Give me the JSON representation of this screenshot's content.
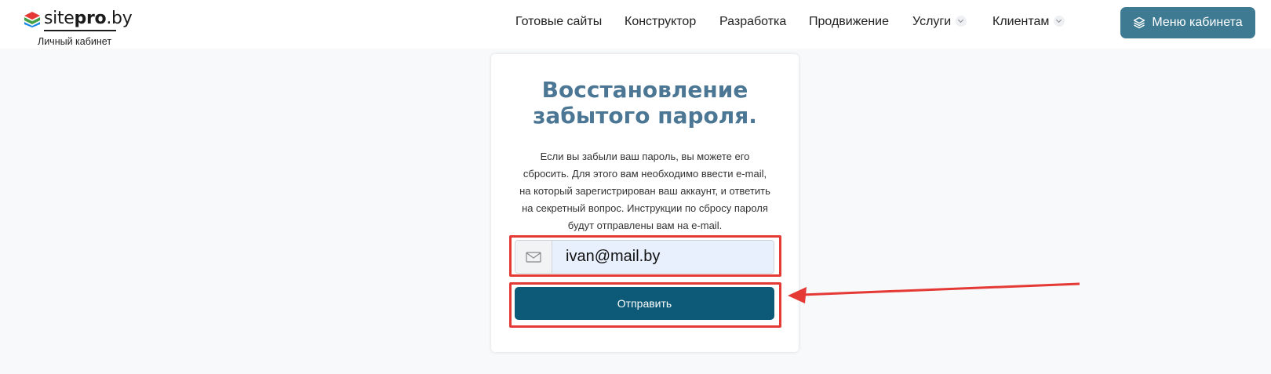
{
  "header": {
    "logo_site": "site",
    "logo_pro": "pro",
    "logo_tld": ".by",
    "logo_subtitle": "Личный кабинет",
    "nav": [
      {
        "label": "Готовые сайты",
        "dropdown": false
      },
      {
        "label": "Конструктор",
        "dropdown": false
      },
      {
        "label": "Разработка",
        "dropdown": false
      },
      {
        "label": "Продвижение",
        "dropdown": false
      },
      {
        "label": "Услуги",
        "dropdown": true
      },
      {
        "label": "Клиентам",
        "dropdown": true
      }
    ],
    "menu_button_label": "Меню кабинета",
    "menu_button_icon": "layers-icon"
  },
  "card": {
    "title_line1": "Восстановление",
    "title_line2": "забытого пароля.",
    "description": "Если вы забыли ваш пароль, вы можете его сбросить. Для этого вам необходимо ввести e-mail, на который зарегистрирован ваш аккаунт, и ответить на секретный вопрос. Инструкции по сбросу пароля будут отправлены вам на e-mail.",
    "email_icon": "envelope-icon",
    "email_value": "ivan@mail.by",
    "submit_label": "Отправить"
  },
  "colors": {
    "accent": "#3f7a93",
    "title": "#4b7694",
    "submit": "#0c5a78",
    "highlight": "#e53935"
  }
}
